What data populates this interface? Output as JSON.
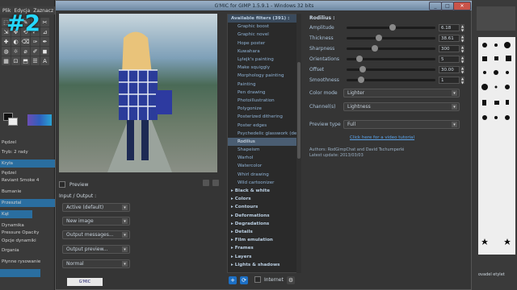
{
  "overlay_label": "#2",
  "gimp": {
    "menu": [
      "Plik",
      "Edycja",
      "Zaznacz"
    ],
    "tool_icons": [
      "⬚",
      "◯",
      "✎",
      "⌖",
      "✂",
      "⇲",
      "✥",
      "⟲",
      "⤢",
      "⊿",
      "✚",
      "◐",
      "⌫",
      "✑",
      "✒",
      "◍",
      "☼",
      "⌀",
      "✐",
      "◼",
      "▦",
      "⊡",
      "⬒",
      "☰",
      "A"
    ],
    "left_labels": [
      "Pędzel",
      "Tryb: 2 rady",
      "Kryła",
      "Pędzel",
      "Reviant Smoke 4",
      "Bumanie",
      "Przesztal",
      "Kąt",
      "Dynamika",
      "Pressure Opacity",
      "Opcje dynamiki",
      "Drgania",
      "Płynne rysowanie"
    ],
    "bottom_label": "GIMP"
  },
  "gmic": {
    "title": "G'MIC for GIMP 1.5.9.1 - Windows 32 bits",
    "preview_label": "Preview",
    "input_output_label": "Input / Output :",
    "combos": [
      "Active (default)",
      "New image",
      "Output messages...",
      "Output preview...",
      "Normal"
    ],
    "available_filters_label": "Available filters (391) :",
    "filters_above": [
      "Graphic boost",
      "Graphic novel",
      "Hope poster",
      "Kuwahara",
      "Lylejk's painting",
      "Make squiggly",
      "Morphology painting",
      "Painting",
      "Pen drawing",
      "Photoillustration",
      "Polygonize",
      "Posterized dithering",
      "Poster edges",
      "Psychedelic glasswork (de"
    ],
    "selected_filter": "Rodilius",
    "filters_below": [
      "Shapeism",
      "Warhol",
      "Watercolor",
      "Whirl drawing",
      "Wild cartoonizer"
    ],
    "categories": [
      "Black & white",
      "Colors",
      "Contours",
      "Deformations",
      "Degradations",
      "Details",
      "Film emulation",
      "Frames",
      "Layers",
      "Lights & shadows"
    ],
    "filter_title": "Rodilius :",
    "params": [
      {
        "label": "Amplitude",
        "value": "6.18",
        "level": 0.52
      },
      {
        "label": "Thickness",
        "value": "38.61",
        "level": 0.35
      },
      {
        "label": "Sharpness",
        "value": "300",
        "level": 0.3
      },
      {
        "label": "Orientations",
        "value": "5",
        "level": 0.12
      },
      {
        "label": "Offset",
        "value": "30.00",
        "level": 0.16
      },
      {
        "label": "Smoothness",
        "value": "1",
        "level": 0.14
      }
    ],
    "color_mode_label": "Color mode",
    "color_mode_value": "Lighter",
    "channels_label": "Channel(s)",
    "channels_value": "Lightness",
    "preview_type_label": "Preview type",
    "preview_type_value": "Full",
    "video_link": "Click here for a video tutorial",
    "authors": "Authors: RodGimpChat and David Tschumperlé",
    "latest_update": "Latest update: 2013/03/03",
    "internet_label": "Internet"
  },
  "right_panel": {
    "caption": "ovadel etylet"
  }
}
